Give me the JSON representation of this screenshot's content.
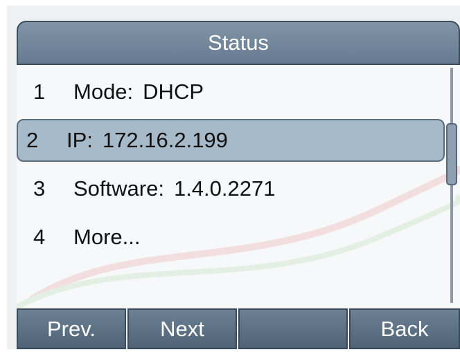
{
  "title_bar": {
    "title": "Status"
  },
  "menu": {
    "items": [
      {
        "number": "1",
        "label": "Mode:",
        "value": "DHCP",
        "selected": false
      },
      {
        "number": "2",
        "label": "IP:",
        "value": "172.16.2.199",
        "selected": true
      },
      {
        "number": "3",
        "label": "Software:",
        "value": "1.4.0.2271",
        "selected": false
      },
      {
        "number": "4",
        "label": "More...",
        "value": "",
        "selected": false
      }
    ]
  },
  "softkeys": {
    "key1": "Prev.",
    "key2": "Next",
    "key3": "",
    "key4": "Back"
  },
  "colors": {
    "title_bar": "#73889c",
    "selection": "#a7bac9",
    "softkey": "#5d7185",
    "text": "#111111"
  }
}
